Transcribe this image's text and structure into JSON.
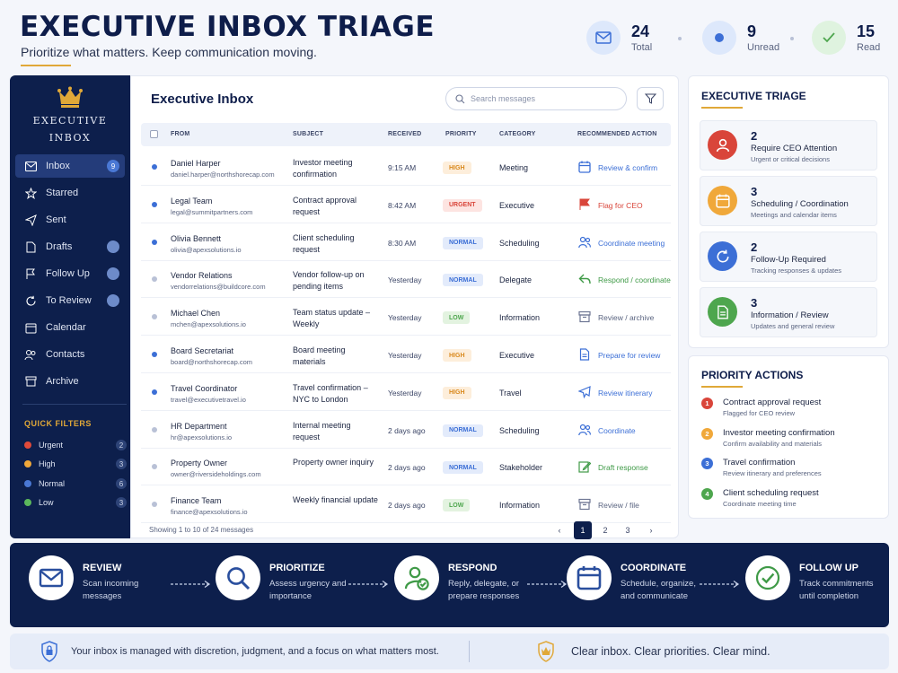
{
  "header": {
    "title": "EXECUTIVE INBOX TRIAGE",
    "subtitle": "Prioritize what matters. Keep communication moving.",
    "stats": [
      {
        "value": "24",
        "label": "Total"
      },
      {
        "value": "9",
        "label": "Unread"
      },
      {
        "value": "15",
        "label": "Read"
      }
    ]
  },
  "sidebar": {
    "logo_line1": "EXECUTIVE",
    "logo_line2": "INBOX",
    "items": [
      {
        "label": "Inbox",
        "badge": "9",
        "icon": "envelope-icon"
      },
      {
        "label": "Starred",
        "badge": "",
        "icon": "star-icon"
      },
      {
        "label": "Sent",
        "badge": "",
        "icon": "send-icon"
      },
      {
        "label": "Drafts",
        "badge": "",
        "icon": "document-icon"
      },
      {
        "label": "Follow Up",
        "badge": "",
        "icon": "flag-icon"
      },
      {
        "label": "To Review",
        "badge": "",
        "icon": "refresh-icon"
      },
      {
        "label": "Calendar",
        "badge": "",
        "icon": "calendar-icon"
      },
      {
        "label": "Contacts",
        "badge": "",
        "icon": "contacts-icon"
      },
      {
        "label": "Archive",
        "badge": "",
        "icon": "archive-icon"
      }
    ],
    "quick_filters_title": "QUICK FILTERS",
    "filters": [
      {
        "label": "Urgent",
        "count": "2",
        "color": "#e04a3a"
      },
      {
        "label": "High",
        "count": "3",
        "color": "#f0a83a"
      },
      {
        "label": "Normal",
        "count": "6",
        "color": "#4a78d4"
      },
      {
        "label": "Low",
        "count": "3",
        "color": "#5cb85c"
      }
    ]
  },
  "inbox": {
    "title": "Executive Inbox",
    "search_placeholder": "Search messages",
    "columns": [
      "FROM",
      "SUBJECT",
      "RECEIVED",
      "PRIORITY",
      "CATEGORY",
      "RECOMMENDED ACTION"
    ],
    "rows": [
      {
        "unread": true,
        "from": "Daniel Harper",
        "email": "daniel.harper@northshorecap.com",
        "subject": "Investor meeting confirmation",
        "received": "9:15 AM",
        "priority": "HIGH",
        "category": "Meeting",
        "action": "Review & confirm",
        "action_icon": "calendar-icon"
      },
      {
        "unread": true,
        "from": "Legal Team",
        "email": "legal@summitpartners.com",
        "subject": "Contract approval request",
        "received": "8:42 AM",
        "priority": "URGENT",
        "category": "Executive",
        "action": "Flag for CEO",
        "action_icon": "flag-icon"
      },
      {
        "unread": true,
        "from": "Olivia Bennett",
        "email": "olivia@apexsolutions.io",
        "subject": "Client scheduling request",
        "received": "8:30 AM",
        "priority": "NORMAL",
        "category": "Scheduling",
        "action": "Coordinate meeting",
        "action_icon": "people-icon"
      },
      {
        "unread": false,
        "from": "Vendor Relations",
        "email": "vendorrelations@buildcore.com",
        "subject": "Vendor follow-up on pending items",
        "received": "Yesterday",
        "priority": "NORMAL",
        "category": "Delegate",
        "action": "Respond / coordinate",
        "action_icon": "reply-icon"
      },
      {
        "unread": false,
        "from": "Michael Chen",
        "email": "mchen@apexsolutions.io",
        "subject": "Team status update – Weekly",
        "received": "Yesterday",
        "priority": "LOW",
        "category": "Information",
        "action": "Review / archive",
        "action_icon": "archive-icon"
      },
      {
        "unread": true,
        "from": "Board Secretariat",
        "email": "board@northshorecap.com",
        "subject": "Board meeting materials",
        "received": "Yesterday",
        "priority": "HIGH",
        "category": "Executive",
        "action": "Prepare for review",
        "action_icon": "document-icon"
      },
      {
        "unread": true,
        "from": "Travel Coordinator",
        "email": "travel@executivetravel.io",
        "subject": "Travel confirmation – NYC to London",
        "received": "Yesterday",
        "priority": "HIGH",
        "category": "Travel",
        "action": "Review itinerary",
        "action_icon": "plane-icon"
      },
      {
        "unread": false,
        "from": "HR Department",
        "email": "hr@apexsolutions.io",
        "subject": "Internal meeting request",
        "received": "2 days ago",
        "priority": "NORMAL",
        "category": "Scheduling",
        "action": "Coordinate",
        "action_icon": "people-icon"
      },
      {
        "unread": false,
        "from": "Property Owner",
        "email": "owner@riversideholdings.com",
        "subject": "Property owner inquiry",
        "received": "2 days ago",
        "priority": "NORMAL",
        "category": "Stakeholder",
        "action": "Draft response",
        "action_icon": "edit-icon"
      },
      {
        "unread": false,
        "from": "Finance Team",
        "email": "finance@apexsolutions.io",
        "subject": "Weekly financial update",
        "received": "2 days ago",
        "priority": "LOW",
        "category": "Information",
        "action": "Review / file",
        "action_icon": "archive-icon"
      }
    ],
    "showing": "Showing 1 to 10 of 24 messages",
    "pages": [
      "1",
      "2",
      "3"
    ],
    "prev_glyph": "‹",
    "next_glyph": "›"
  },
  "triage": {
    "title": "EXECUTIVE TRIAGE",
    "cards": [
      {
        "count": "2",
        "title": "Require CEO Attention",
        "sub": "Urgent or critical decisions",
        "color": "#d9453a",
        "icon": "person-icon"
      },
      {
        "count": "3",
        "title": "Scheduling / Coordination",
        "sub": "Meetings and calendar items",
        "color": "#f0a83a",
        "icon": "calendar-icon"
      },
      {
        "count": "2",
        "title": "Follow-Up Required",
        "sub": "Tracking responses & updates",
        "color": "#3c6fd6",
        "icon": "refresh-icon"
      },
      {
        "count": "3",
        "title": "Information / Review",
        "sub": "Updates and general review",
        "color": "#4ea64e",
        "icon": "document-icon"
      }
    ]
  },
  "priority_actions": {
    "title": "PRIORITY ACTIONS",
    "items": [
      {
        "n": "1",
        "title": "Contract approval request",
        "sub": "Flagged for CEO review",
        "color": "#d9453a"
      },
      {
        "n": "2",
        "title": "Investor meeting confirmation",
        "sub": "Confirm availability and materials",
        "color": "#f0a83a"
      },
      {
        "n": "3",
        "title": "Travel confirmation",
        "sub": "Review itinerary and preferences",
        "color": "#3c6fd6"
      },
      {
        "n": "4",
        "title": "Client scheduling request",
        "sub": "Coordinate meeting time",
        "color": "#4ea64e"
      }
    ]
  },
  "workflow": [
    {
      "title": "REVIEW",
      "desc": "Scan incoming messages",
      "icon": "envelope-icon"
    },
    {
      "title": "PRIORITIZE",
      "desc": "Assess urgency and importance",
      "icon": "search-icon"
    },
    {
      "title": "RESPOND",
      "desc": "Reply, delegate, or prepare responses",
      "icon": "person-check-icon"
    },
    {
      "title": "COORDINATE",
      "desc": "Schedule, organize, and communicate",
      "icon": "calendar-icon"
    },
    {
      "title": "FOLLOW UP",
      "desc": "Track commitments until completion",
      "icon": "check-circle-icon"
    }
  ],
  "footer": {
    "left": "Your inbox is managed with discretion, judgment, and a focus on what matters most.",
    "right": "Clear inbox. Clear priorities. Clear mind."
  }
}
